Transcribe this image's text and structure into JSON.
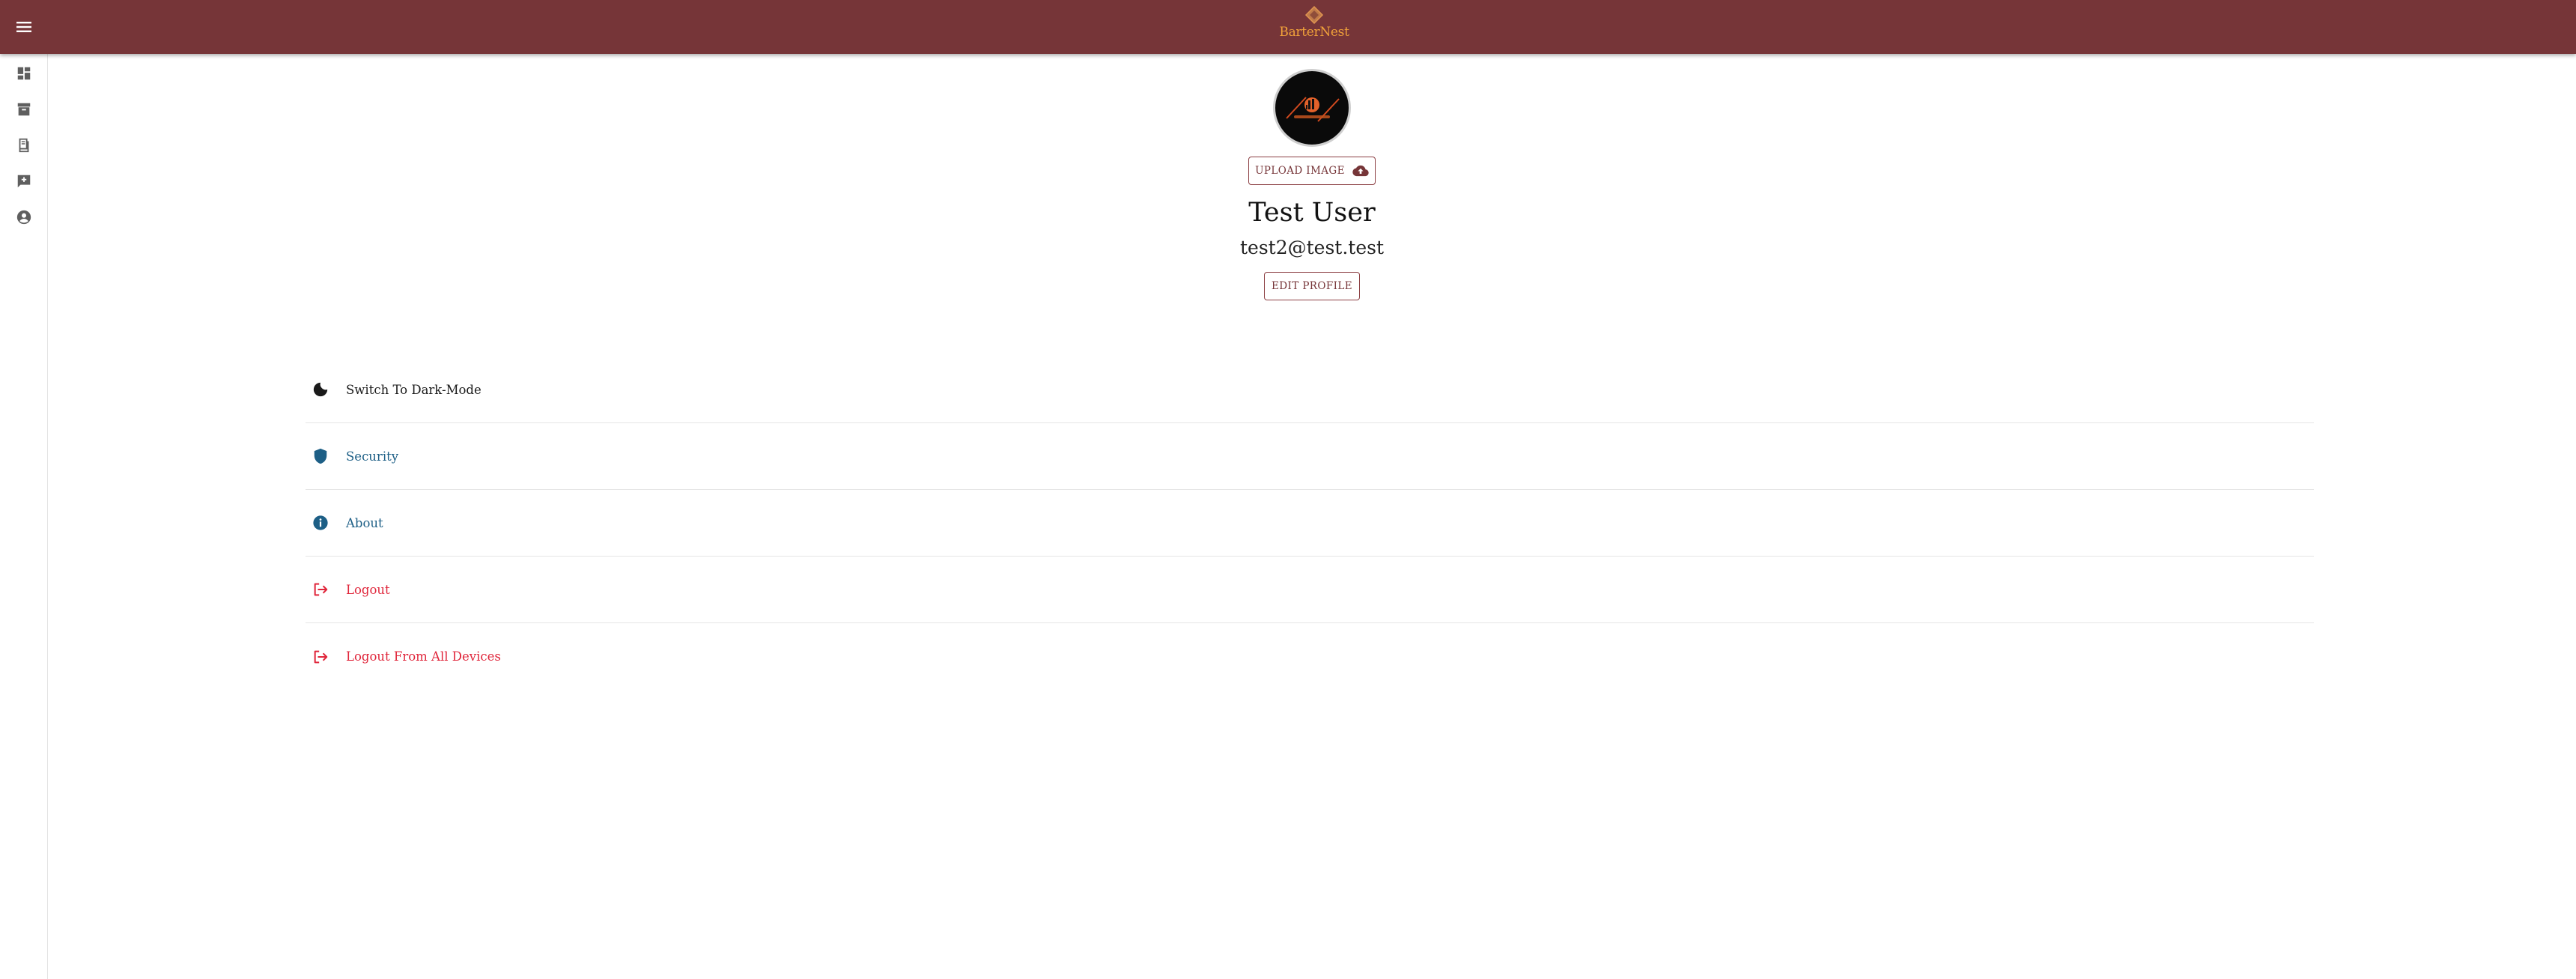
{
  "header": {
    "menu_icon": "hamburger-menu-icon",
    "logo_text": "BarterNest",
    "colors": {
      "bar": "#763538",
      "logo": "#f0a13a"
    }
  },
  "sidebar": {
    "items": [
      {
        "icon": "dashboard-icon"
      },
      {
        "icon": "archive-box-icon"
      },
      {
        "icon": "receipt-icon"
      },
      {
        "icon": "feedback-icon"
      },
      {
        "icon": "account-circle-icon"
      }
    ]
  },
  "profile": {
    "upload_label": "UPLOAD IMAGE",
    "upload_icon": "cloud-upload-icon",
    "name": "Test User",
    "email": "test2@test.test",
    "edit_label": "EDIT PROFILE"
  },
  "settings": {
    "items": [
      {
        "label": "Switch To Dark-Mode",
        "icon": "moon-icon",
        "color": "#1a1a1a"
      },
      {
        "label": "Security",
        "icon": "shield-icon",
        "color": "#1d5f86"
      },
      {
        "label": "About",
        "icon": "info-icon",
        "color": "#1d5f86"
      },
      {
        "label": "Logout",
        "icon": "logout-icon",
        "color": "#e0263b"
      },
      {
        "label": "Logout From All Devices",
        "icon": "logout-icon",
        "color": "#e0263b"
      }
    ]
  }
}
